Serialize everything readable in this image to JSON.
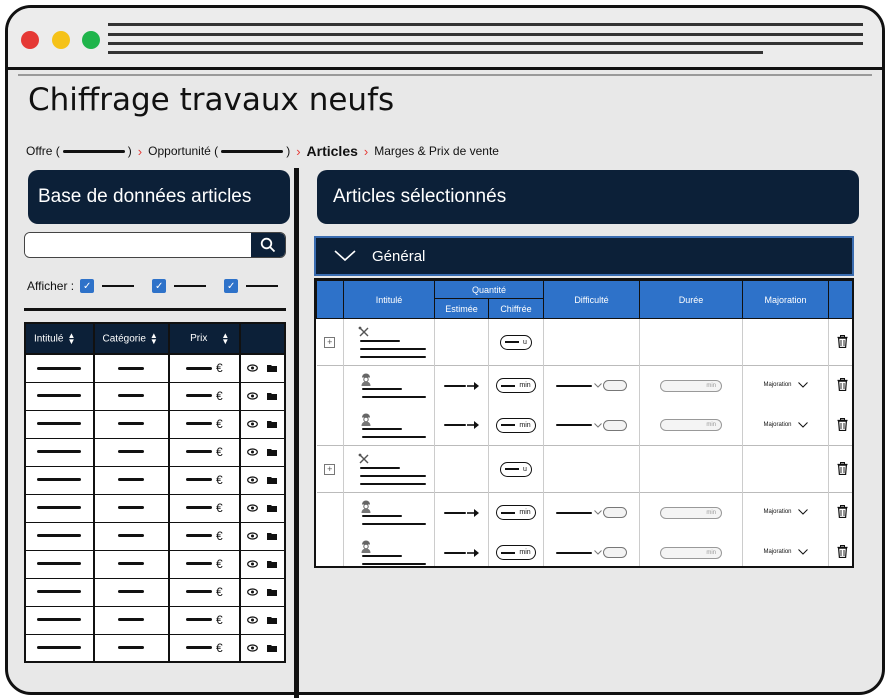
{
  "page": {
    "title": "Chiffrage travaux neufs",
    "breadcrumb": [
      {
        "label": "Offre (",
        "suffix": ")",
        "blank": true,
        "active": false
      },
      {
        "label": "Opportunité (",
        "suffix": ")",
        "blank": true,
        "active": false
      },
      {
        "label": "Articles",
        "suffix": "",
        "blank": false,
        "active": true
      },
      {
        "label": "Marges & Prix de vente",
        "suffix": "",
        "blank": false,
        "active": false
      }
    ]
  },
  "left": {
    "title": "Base de données articles",
    "search": {
      "placeholder": "",
      "icon": "search-icon"
    },
    "afficher_label": "Afficher :",
    "filters": [
      true,
      true,
      true
    ],
    "columns": [
      "Intitulé",
      "Catégorie",
      "Prix",
      ""
    ],
    "currency": "€",
    "row_count": 11
  },
  "right": {
    "title": "Articles sélectionnés",
    "section": "Général",
    "headers": {
      "intitule": "Intitulé",
      "quantite": "Quantité",
      "estimee": "Estimée",
      "chiffree": "Chiffrée",
      "difficulte": "Difficulté",
      "duree": "Durée",
      "majoration": "Majoration"
    },
    "units": {
      "group": "u",
      "item": "min",
      "duree": "min"
    },
    "majoration_label": "Majoration"
  },
  "colors": {
    "navy": "#0c2038",
    "blue": "#2e72c9",
    "red": "#e53935",
    "yellow": "#f5c218",
    "green": "#1fb44b"
  }
}
